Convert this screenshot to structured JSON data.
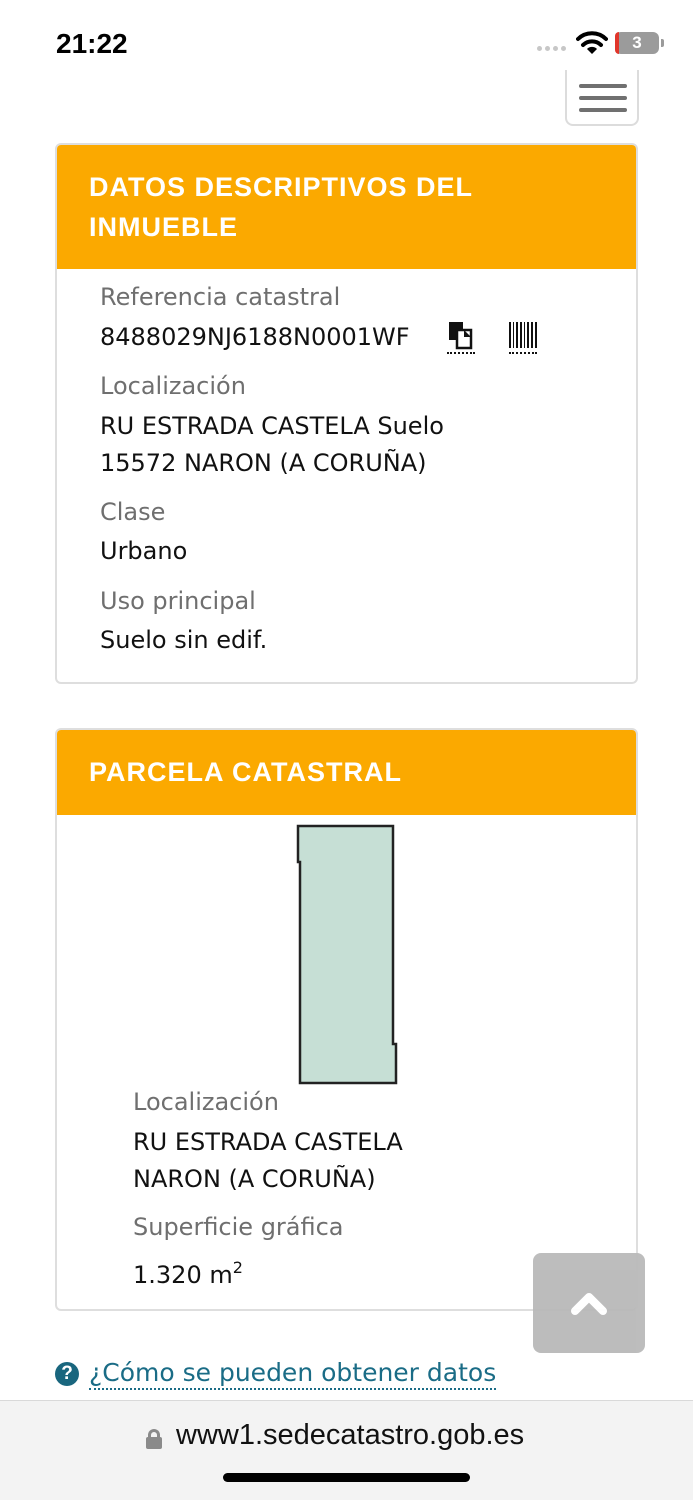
{
  "status": {
    "time": "21:22",
    "battery": "3"
  },
  "panel1": {
    "title_line1": "DATOS DESCRIPTIVOS DEL",
    "title_line2": "INMUEBLE",
    "ref_label": "Referencia catastral",
    "ref_value": "8488029NJ6188N0001WF",
    "loc_label": "Localización",
    "loc_line1": "RU ESTRADA CASTELA Suelo",
    "loc_line2": "15572 NARON (A CORUÑA)",
    "clase_label": "Clase",
    "clase_value": "Urbano",
    "uso_label": "Uso principal",
    "uso_value": "Suelo sin edif."
  },
  "panel2": {
    "title": "PARCELA CATASTRAL",
    "loc_label": "Localización",
    "loc_line1": "RU ESTRADA CASTELA",
    "loc_line2": "NARON (A CORUÑA)",
    "sup_label": "Superficie gráfica",
    "sup_value": "1.320 m",
    "sup_unit_exp": "2"
  },
  "help_link": "¿Cómo se pueden obtener datos",
  "browser": {
    "url": "www1.sedecatastro.gob.es"
  },
  "colors": {
    "header": "#fba900",
    "parcel_fill": "#c6dfd5",
    "link": "#1a6c86"
  },
  "icons": [
    "wifi-icon",
    "copy-icon",
    "barcode-icon",
    "chevron-up-icon",
    "help-icon",
    "lock-icon",
    "menu-icon"
  ]
}
